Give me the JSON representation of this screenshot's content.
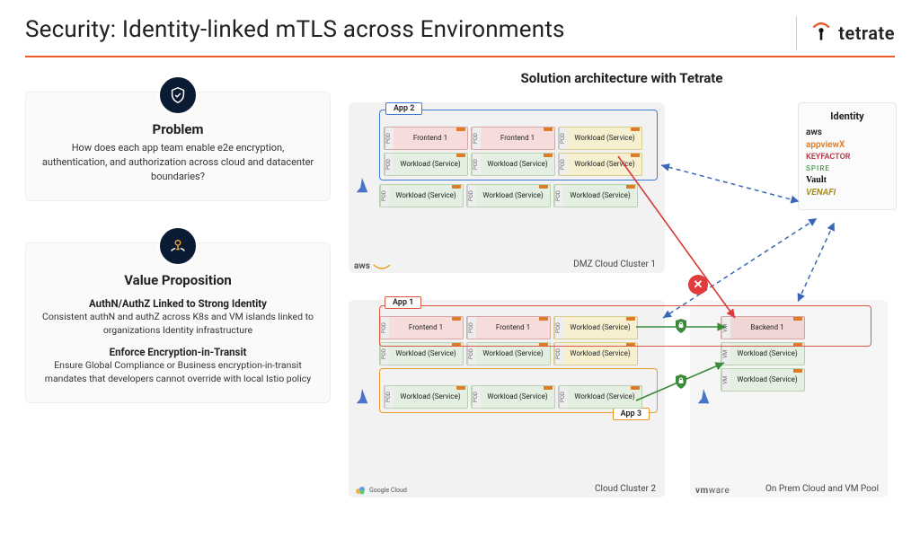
{
  "title": "Security: Identity-linked mTLS across Environments",
  "brand": "tetrate",
  "left": {
    "problem": {
      "title": "Problem",
      "body": "How does each app team enable e2e encryption, authentication, and authorization across cloud and datacenter boundaries?"
    },
    "value": {
      "title": "Value Proposition",
      "sub1_title": "AuthN/AuthZ Linked to Strong Identity",
      "sub1_body": "Consistent authN and authZ across K8s and VM islands linked to organizations Identity infrastructure",
      "sub2_title": "Enforce Encryption-in-Transit",
      "sub2_body": "Ensure Global Compliance or Business encryption-in-transit mandates that developers cannot override with local Istio policy"
    }
  },
  "arch_title": "Solution architecture with Tetrate",
  "labels": {
    "pod": "POD",
    "vm": "VM",
    "frontend": "Frontend 1",
    "workload": "Workload (Service)",
    "backend": "Backend 1",
    "app1": "App 1",
    "app2": "App 2",
    "app3": "App 3"
  },
  "clusters": {
    "dmz": {
      "label": "DMZ Cloud Cluster 1",
      "platform": "aws"
    },
    "cc2": {
      "label": "Cloud Cluster 2",
      "platform": "Google Cloud"
    },
    "onprem": {
      "label": "On Prem Cloud and VM Pool",
      "platform": "vmware"
    }
  },
  "identity": {
    "title": "Identity",
    "providers": [
      "aws",
      "appviewX",
      "KEYFACTOR",
      "SPIRE",
      "Vault",
      "VENAFI"
    ]
  }
}
